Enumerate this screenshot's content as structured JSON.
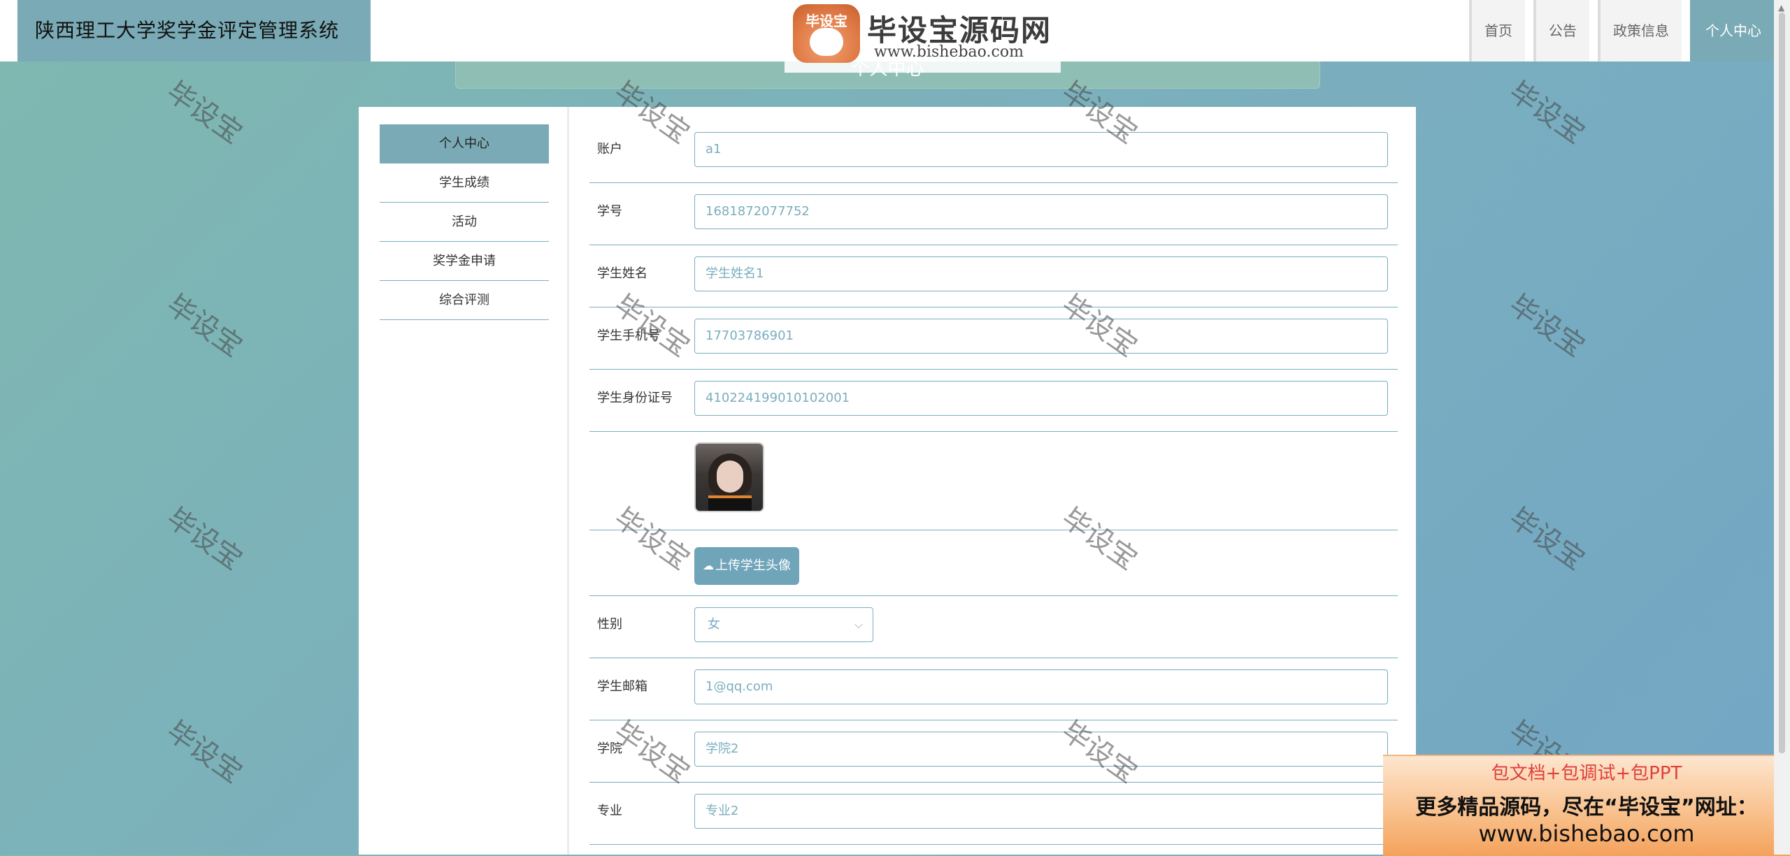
{
  "app": {
    "title": "陕西理工大学奖学金评定管理系统"
  },
  "nav": {
    "items": [
      {
        "label": "首页",
        "active": false
      },
      {
        "label": "公告",
        "active": false
      },
      {
        "label": "政策信息",
        "active": false
      },
      {
        "label": "个人中心",
        "active": true
      }
    ]
  },
  "logo": {
    "badge_text": "毕设宝",
    "title": "毕设宝源码网",
    "url": "www.bishebao.com"
  },
  "page": {
    "title": "个人中心"
  },
  "sidebar": {
    "items": [
      {
        "label": "个人中心",
        "active": true
      },
      {
        "label": "学生成绩",
        "active": false
      },
      {
        "label": "活动",
        "active": false
      },
      {
        "label": "奖学金申请",
        "active": false
      },
      {
        "label": "综合评测",
        "active": false
      }
    ]
  },
  "form": {
    "account": {
      "label": "账户",
      "value": "a1"
    },
    "student_id": {
      "label": "学号",
      "value": "1681872077752"
    },
    "student_name": {
      "label": "学生姓名",
      "value": "学生姓名1"
    },
    "student_phone": {
      "label": "学生手机号",
      "value": "17703786901"
    },
    "student_idcard": {
      "label": "学生身份证号",
      "value": "410224199010102001"
    },
    "avatar": {
      "upload_label": "上传学生头像"
    },
    "gender": {
      "label": "性别",
      "value": "女"
    },
    "email": {
      "label": "学生邮箱",
      "value": "1@qq.com"
    },
    "college": {
      "label": "学院",
      "value": "学院2"
    },
    "major": {
      "label": "专业",
      "value": "专业2"
    }
  },
  "watermark": {
    "text": "毕设宝"
  },
  "ad": {
    "line1": "包文档+包调试+包PPT",
    "line2": "更多精品源码，尽在“毕设宝”网址：",
    "line3": "www.bishebao.com"
  },
  "colors": {
    "accent": "#79aab5",
    "border": "#7aaebf",
    "button": "#6fa4b9"
  }
}
